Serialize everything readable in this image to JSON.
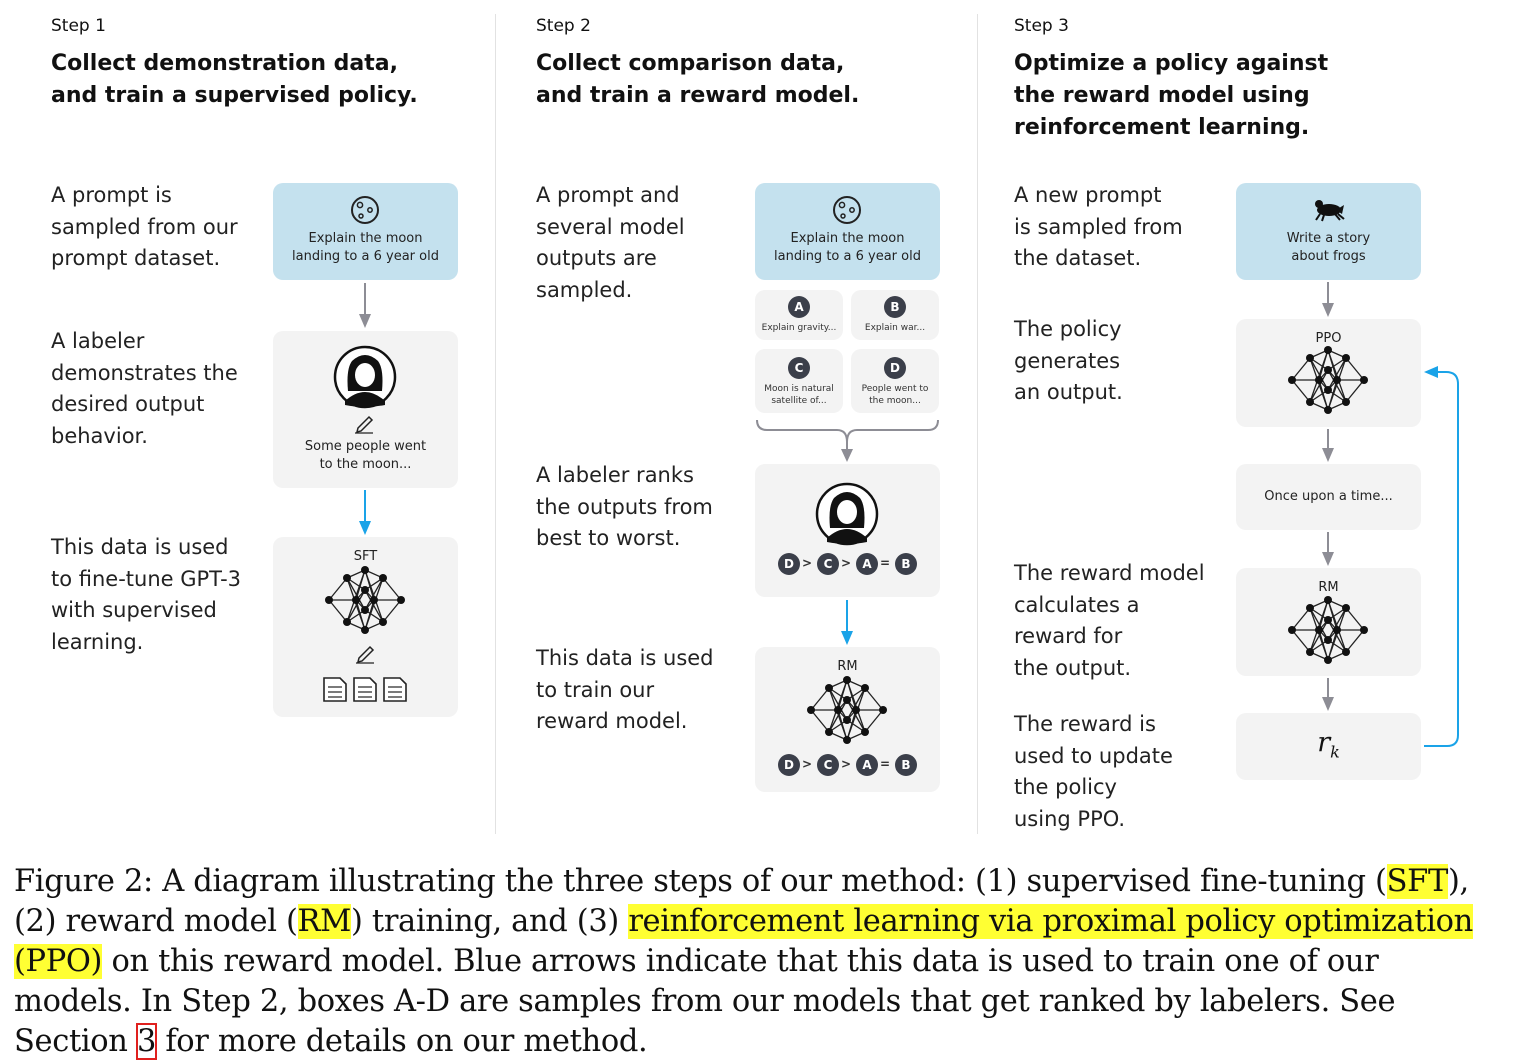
{
  "steps": [
    {
      "label": "Step 1",
      "title": [
        "Collect demonstration data,",
        "and train a supervised policy."
      ],
      "descriptions": [
        [
          "A prompt is",
          "sampled from our",
          "prompt dataset."
        ],
        [
          "A labeler",
          "demonstrates the",
          "desired output",
          "behavior."
        ],
        [
          "This data is used",
          "to fine-tune GPT-3",
          "with supervised",
          "learning."
        ]
      ],
      "prompt_box": [
        "Explain the moon",
        "landing to a 6 year old"
      ],
      "output_box": [
        "Some people went",
        "to the moon..."
      ],
      "model_label": "SFT"
    },
    {
      "label": "Step 2",
      "title": [
        "Collect comparison data,",
        "and train a reward model."
      ],
      "descriptions": [
        [
          "A prompt and",
          "several model",
          "outputs are",
          "sampled."
        ],
        [
          "A labeler ranks",
          "the outputs from",
          "best to worst."
        ],
        [
          "This data is used",
          "to train our",
          "reward model."
        ]
      ],
      "prompt_box": [
        "Explain the moon",
        "landing to a 6 year old"
      ],
      "samples": [
        {
          "letter": "A",
          "text": [
            "Explain gravity..."
          ]
        },
        {
          "letter": "B",
          "text": [
            "Explain war..."
          ]
        },
        {
          "letter": "C",
          "text": [
            "Moon is natural",
            "satellite of..."
          ]
        },
        {
          "letter": "D",
          "text": [
            "People went to",
            "the moon..."
          ]
        }
      ],
      "ranking": [
        "D",
        ">",
        "C",
        ">",
        "A",
        "=",
        "B"
      ],
      "model_label": "RM"
    },
    {
      "label": "Step 3",
      "title": [
        "Optimize a policy against",
        "the reward model using",
        "reinforcement learning."
      ],
      "descriptions": [
        [
          "A new prompt",
          "is sampled from",
          "the dataset."
        ],
        [
          "The policy",
          "generates",
          "an output."
        ],
        [
          "The reward model",
          "calculates a",
          "reward for",
          "the output."
        ],
        [
          "The reward is",
          "used to update",
          "the policy",
          "using PPO."
        ]
      ],
      "prompt_box": [
        "Write a story",
        "about frogs"
      ],
      "policy_label": "PPO",
      "output_text": "Once upon a time...",
      "model_label": "RM",
      "reward_symbol": "r",
      "reward_subscript": "k"
    }
  ],
  "caption": {
    "p1": "Figure 2: A diagram illustrating the three steps of our method: (1) supervised fine-tuning (",
    "sft": "SFT",
    "p2": "), (2) reward model (",
    "rm": "RM",
    "p3": ") training, and (3) ",
    "ppo": "reinforcement learning via proximal policy optimization (PPO)",
    "p4": " on this reward model. Blue arrows indicate that this data is used to train one of our models. In Step 2, boxes A-D are samples from our models that get ranked by labelers. See Section ",
    "ref": "3",
    "p5": " for more details on our method."
  },
  "colors": {
    "prompt_box": "#c4e1ee",
    "grey_box": "#f3f3f3",
    "blue_arrow": "#1aa3e8",
    "grey_arrow": "#8d8d95",
    "highlight": "#ffff33",
    "ref_box": "#e0201e"
  }
}
